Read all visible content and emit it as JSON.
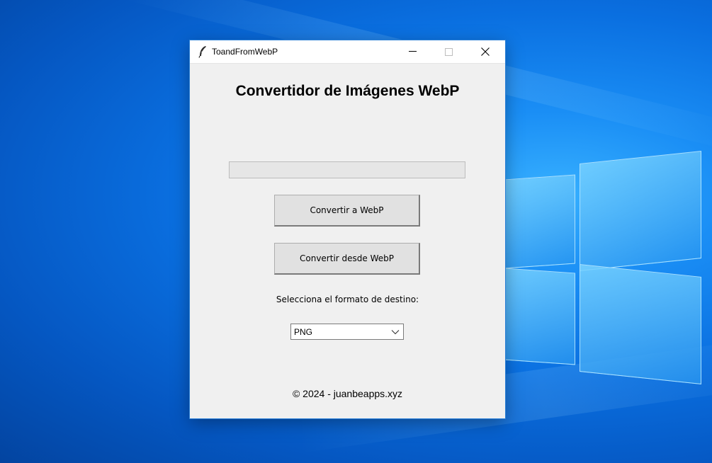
{
  "window": {
    "title": "ToandFromWebP",
    "icon": "feather-icon",
    "controls": {
      "minimize": "minimize-icon",
      "maximize": "maximize-icon",
      "close": "close-icon"
    }
  },
  "main": {
    "heading": "Convertidor de Imágenes WebP",
    "progress_percent": 0,
    "convert_to_label": "Convertir a WebP",
    "convert_from_label": "Convertir desde WebP",
    "format_label": "Selecciona el formato de destino:",
    "format_select": {
      "selected": "PNG",
      "icon": "chevron-down-icon"
    },
    "footer": "© 2024 - juanbeapps.xyz"
  },
  "colors": {
    "desktop_accent": "#0a6fe0",
    "window_bg": "#f0f0f0",
    "button_bg": "#e1e1e1",
    "progress_fill": "#06b025"
  }
}
